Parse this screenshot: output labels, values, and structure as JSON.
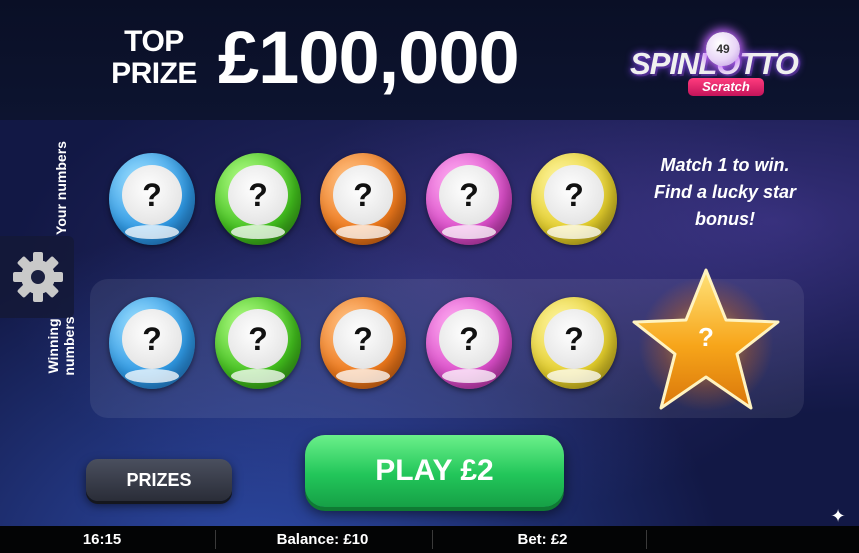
{
  "header": {
    "top_prize_label": "TOP\nPRIZE",
    "top_prize_amount": "£100,000",
    "logo": {
      "number": "49",
      "word": "SPINLOTTO",
      "sub": "Scratch"
    }
  },
  "labels": {
    "your_numbers": "Your numbers",
    "winning_numbers": "Winning numbers"
  },
  "your_numbers": [
    {
      "color": "blue",
      "value": "?"
    },
    {
      "color": "green",
      "value": "?"
    },
    {
      "color": "orange",
      "value": "?"
    },
    {
      "color": "pink",
      "value": "?"
    },
    {
      "color": "yellow",
      "value": "?"
    }
  ],
  "winning_numbers": [
    {
      "color": "blue",
      "value": "?"
    },
    {
      "color": "green",
      "value": "?"
    },
    {
      "color": "orange",
      "value": "?"
    },
    {
      "color": "pink",
      "value": "?"
    },
    {
      "color": "yellow",
      "value": "?"
    }
  ],
  "instructions": "Match 1 to win. Find a lucky star bonus!",
  "star_bonus": {
    "value": "?"
  },
  "buttons": {
    "prizes": "PRIZES",
    "play": "PLAY £2"
  },
  "status_bar": {
    "time": "16:15",
    "balance": "Balance: £10",
    "bet": "Bet: £2"
  },
  "icons": {
    "settings": "gear-icon",
    "bonus": "star-icon",
    "corner": "sparkle-icon"
  }
}
